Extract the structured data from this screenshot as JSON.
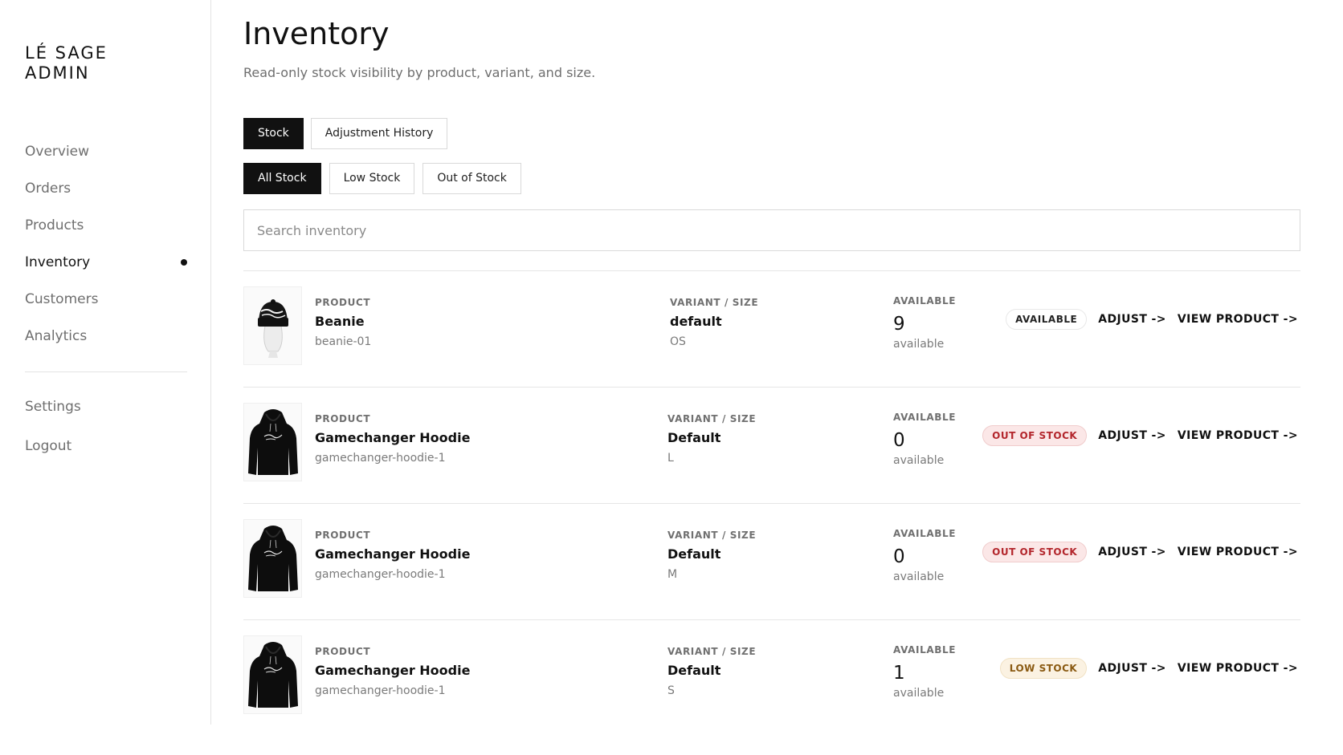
{
  "brand": {
    "line1": "LÉ SAGE",
    "line2": "ADMIN"
  },
  "nav": {
    "items": [
      {
        "label": "Overview"
      },
      {
        "label": "Orders"
      },
      {
        "label": "Products"
      },
      {
        "label": "Inventory",
        "active": true
      },
      {
        "label": "Customers"
      },
      {
        "label": "Analytics"
      }
    ],
    "secondary": [
      {
        "label": "Settings"
      },
      {
        "label": "Logout"
      }
    ]
  },
  "page": {
    "title": "Inventory",
    "subtitle": "Read-only stock visibility by product, variant, and size."
  },
  "tabs": [
    {
      "label": "Stock",
      "active": true
    },
    {
      "label": "Adjustment History",
      "active": false
    }
  ],
  "filters": [
    {
      "label": "All Stock",
      "active": true
    },
    {
      "label": "Low Stock",
      "active": false
    },
    {
      "label": "Out of Stock",
      "active": false
    }
  ],
  "search": {
    "placeholder": "Search inventory",
    "value": ""
  },
  "labels": {
    "product": "PRODUCT",
    "variant": "VARIANT / SIZE",
    "available": "AVAILABLE",
    "available_sub": "available",
    "adjust": "ADJUST ->",
    "view_product": "VIEW PRODUCT ->"
  },
  "rows": [
    {
      "product": "Beanie",
      "sku": "beanie-01",
      "variant": "default",
      "size": "OS",
      "available": "9",
      "status": "AVAILABLE",
      "status_kind": "ok",
      "image": "beanie-icon"
    },
    {
      "product": "Gamechanger Hoodie",
      "sku": "gamechanger-hoodie-1",
      "variant": "Default",
      "size": "L",
      "available": "0",
      "status": "OUT OF STOCK",
      "status_kind": "out",
      "image": "hoodie-icon"
    },
    {
      "product": "Gamechanger Hoodie",
      "sku": "gamechanger-hoodie-1",
      "variant": "Default",
      "size": "M",
      "available": "0",
      "status": "OUT OF STOCK",
      "status_kind": "out",
      "image": "hoodie-icon"
    },
    {
      "product": "Gamechanger Hoodie",
      "sku": "gamechanger-hoodie-1",
      "variant": "Default",
      "size": "S",
      "available": "1",
      "status": "LOW STOCK",
      "status_kind": "low",
      "image": "hoodie-icon"
    }
  ]
}
